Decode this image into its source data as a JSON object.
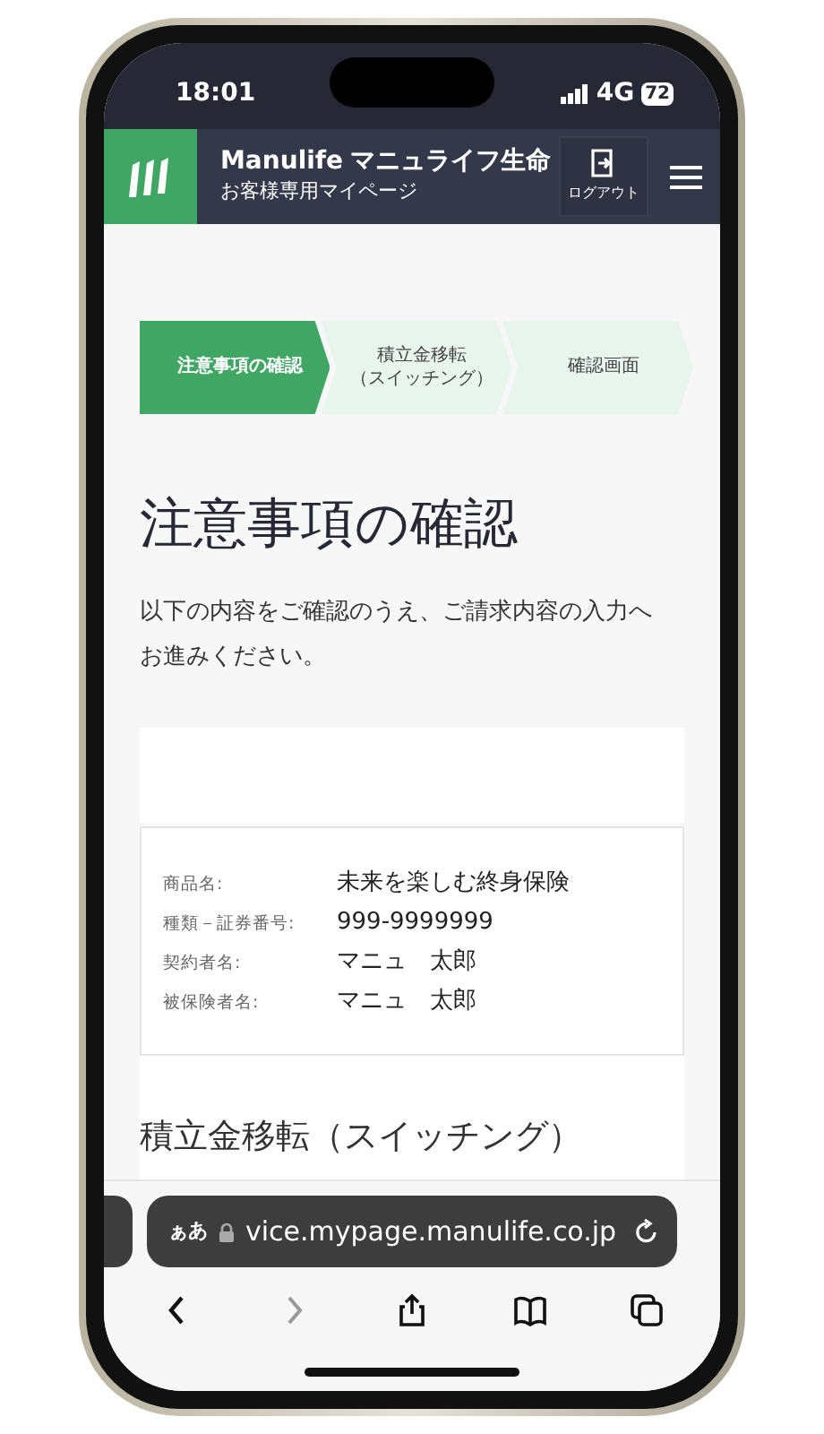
{
  "status_bar": {
    "time": "18:01",
    "network": "4G",
    "battery": "72"
  },
  "header": {
    "brand": "Manulife",
    "brand_sub": "マニュライフ生命",
    "subtitle": "お客様専用マイページ",
    "logout": "ログアウト"
  },
  "steps": [
    {
      "lines": [
        "注意事項の確認"
      ],
      "selected": true
    },
    {
      "lines": [
        "積立金移転",
        "（スイッチング）"
      ],
      "selected": false
    },
    {
      "lines": [
        "確認画面"
      ],
      "selected": false
    }
  ],
  "title": "注意事項の確認",
  "intro": "以下の内容をご確認のうえ、ご請求内容の入力へお進みください。",
  "details": [
    {
      "label": "商品名:",
      "value": "未来を楽しむ終身保険"
    },
    {
      "label": "種類－証券番号:",
      "value": "999-9999999"
    },
    {
      "label": "契約者名:",
      "value": "マニュ　太郎"
    },
    {
      "label": "被保険者名:",
      "value": "マニュ　太郎"
    }
  ],
  "section_heading": "積立金移転（スイッチング）",
  "browser": {
    "text_size": "ぁあ",
    "url": "vice.mypage.manulife.co.jp"
  }
}
